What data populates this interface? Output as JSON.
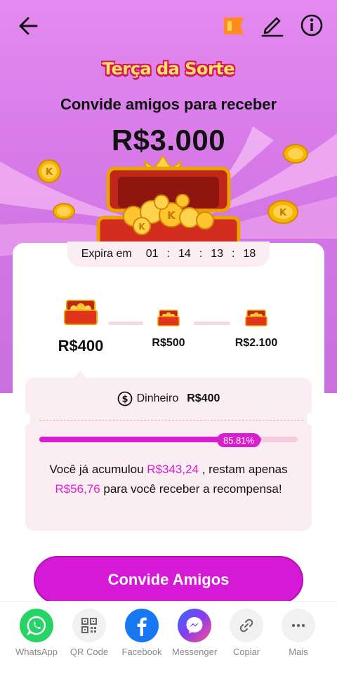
{
  "header": {
    "brand_title": "Terça da Sorte",
    "subtitle": "Convide amigos para receber",
    "amount": "R$3.000"
  },
  "timer": {
    "label": "Expira em",
    "hours": "01",
    "minutes": "14",
    "seconds": "13",
    "frames": "18",
    "separator": ":"
  },
  "tiers": [
    {
      "value": "R$400",
      "active": true
    },
    {
      "value": "R$500",
      "active": false
    },
    {
      "value": "R$2.100",
      "active": false
    }
  ],
  "progress": {
    "money_label": "Dinheiro",
    "money_value": "R$400",
    "percent_label": "85.81%",
    "fraction": 0.8581,
    "msg_part1": "Você já acumulou ",
    "msg_accum": "R$343,24",
    "msg_part2": " , restam apenas ",
    "msg_remaining": "R$56,76",
    "msg_part3": " para você receber a recompensa!"
  },
  "invite_button": "Convide Amigos",
  "share": [
    {
      "label": "WhatsApp",
      "icon": "whatsapp-icon",
      "color": "#25d366"
    },
    {
      "label": "QR Code",
      "icon": "qr-code-icon",
      "color": "#f1f1f1"
    },
    {
      "label": "Facebook",
      "icon": "facebook-icon",
      "color": "#1877f2"
    },
    {
      "label": "Messenger",
      "icon": "messenger-icon",
      "color": "#8a3cf0"
    },
    {
      "label": "Copiar",
      "icon": "link-icon",
      "color": "#f1f1f1"
    },
    {
      "label": "Mais",
      "icon": "more-icon",
      "color": "#f1f1f1"
    }
  ],
  "colors": {
    "accent": "#d81fd0",
    "hero_bg": "#dc80ec",
    "panel_bg": "#fbeef3"
  }
}
